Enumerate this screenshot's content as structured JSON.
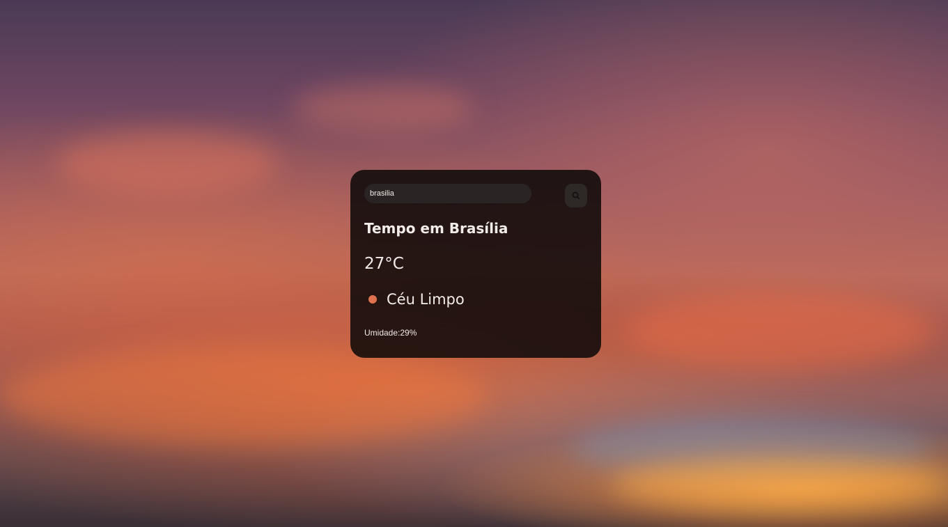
{
  "search": {
    "value": "brasilia",
    "button_icon": "search-icon"
  },
  "weather": {
    "title": "Tempo em Brasília",
    "temperature": "27°C",
    "condition": "Céu Limpo",
    "condition_icon": "clear-sky-dot-icon",
    "humidity": "Umidade:29%"
  },
  "colors": {
    "card_background": "#0c0808",
    "text": "#f2ece8",
    "condition_dot": "#e0714f",
    "input_background": "#2a2524"
  }
}
